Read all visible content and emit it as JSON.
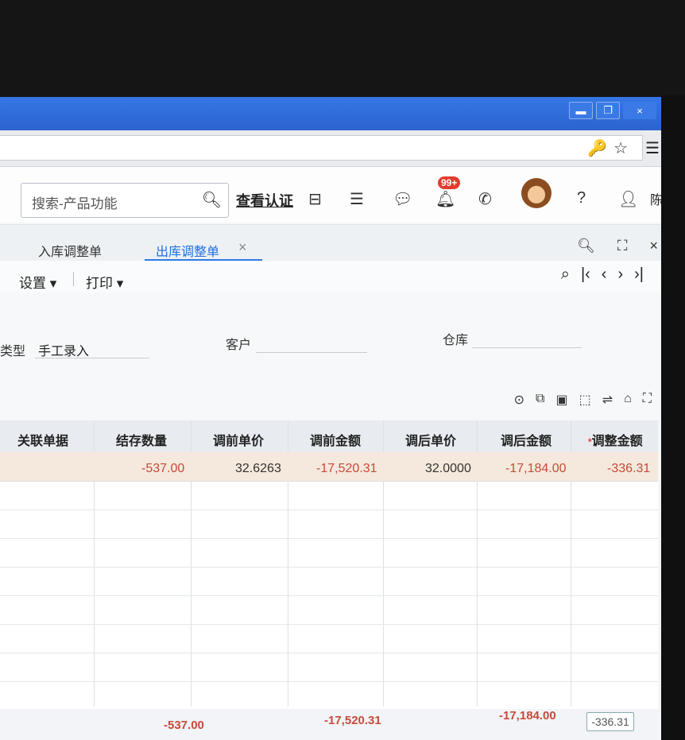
{
  "window": {
    "minimize": "▬",
    "restore": "❐",
    "close": "×"
  },
  "header": {
    "search_placeholder": "搜索-产品功能",
    "cert_link": "查看认证",
    "notif_badge": "99+",
    "user_initial": "陈"
  },
  "tabs": [
    {
      "label": "入库调整单",
      "active": false
    },
    {
      "label": "出库调整单",
      "active": true
    }
  ],
  "toolbar": {
    "settings": "设置",
    "print": "打印"
  },
  "form": {
    "type_label": "类型",
    "type_value": "手工录入",
    "customer_label": "客户",
    "customer_value": "",
    "warehouse_label": "仓库",
    "warehouse_value": ""
  },
  "table": {
    "columns": [
      "关联单据",
      "结存数量",
      "调前单价",
      "调前金额",
      "调后单价",
      "调后金额",
      "调整金额"
    ],
    "rows": [
      {
        "related": "",
        "stock_qty": "-537.00",
        "pre_price": "32.6263",
        "pre_amount": "-17,520.31",
        "post_price": "32.0000",
        "post_amount": "-17,184.00",
        "adj_amount": "-336.31"
      }
    ],
    "totals": {
      "stock_qty": "-537.00",
      "pre_amount": "-17,520.31",
      "post_amount": "-17,184.00",
      "adj_amount": "-336.31"
    }
  },
  "colors": {
    "accent": "#2f7be6",
    "negative": "#c74a3a",
    "title_bar": "#2b63cf"
  }
}
